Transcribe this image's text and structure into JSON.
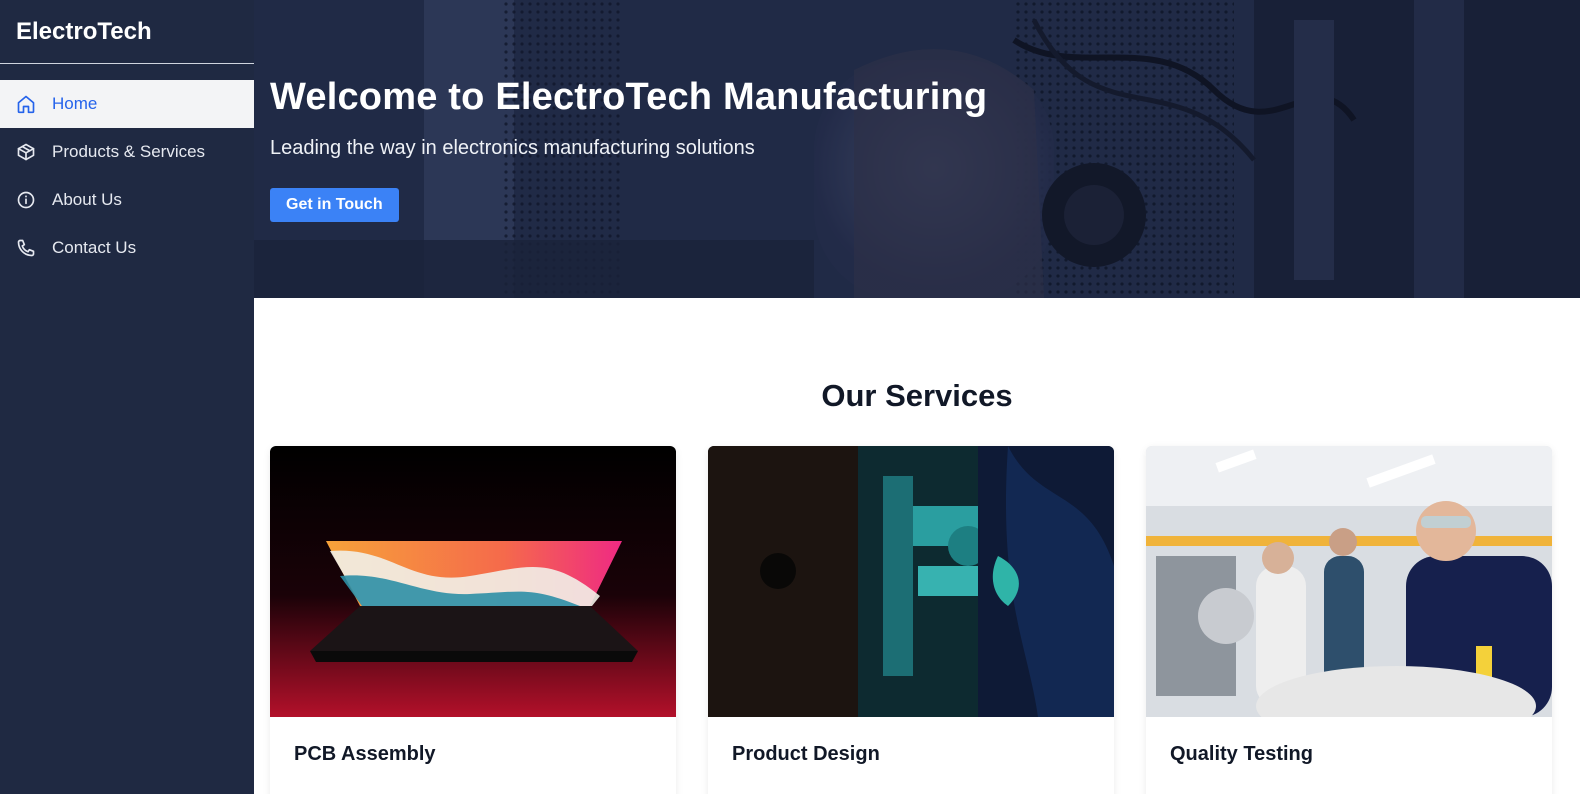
{
  "sidebar": {
    "brand": "ElectroTech",
    "items": [
      {
        "label": "Home",
        "icon": "home-icon",
        "active": true
      },
      {
        "label": "Products & Services",
        "icon": "box-icon",
        "active": false
      },
      {
        "label": "About Us",
        "icon": "info-icon",
        "active": false
      },
      {
        "label": "Contact Us",
        "icon": "phone-icon",
        "active": false
      }
    ]
  },
  "hero": {
    "title": "Welcome to ElectroTech Manufacturing",
    "subtitle": "Leading the way in electronics manufacturing solutions",
    "button_label": "Get in Touch"
  },
  "services": {
    "title": "Our Services",
    "cards": [
      {
        "title": "PCB Assembly",
        "image": "laptop-photo"
      },
      {
        "title": "Product Design",
        "image": "machinery-photo"
      },
      {
        "title": "Quality Testing",
        "image": "lab-engineers-photo"
      }
    ]
  },
  "colors": {
    "sidebar_bg": "#1f2942",
    "accent": "#3b82f6",
    "active_text": "#2563eb",
    "active_bg": "#f3f4f6"
  }
}
